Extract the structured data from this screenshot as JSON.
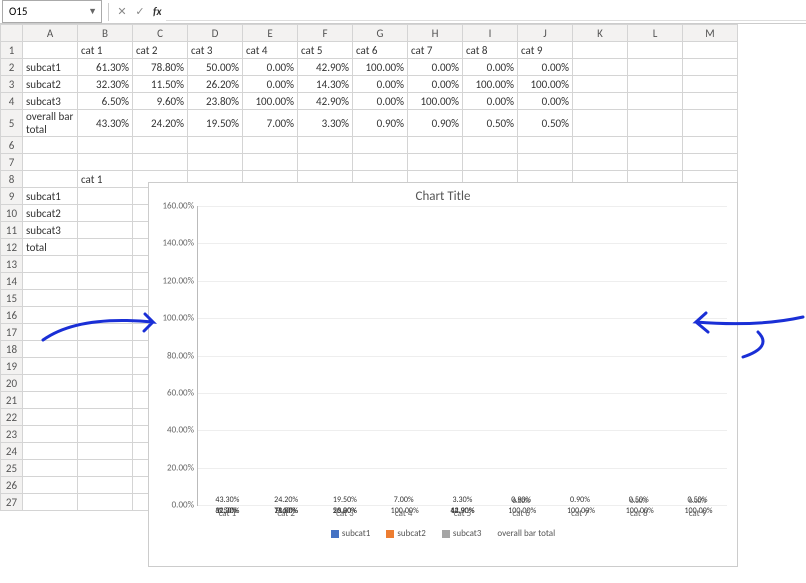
{
  "namebox": {
    "value": "O15"
  },
  "fbar": {
    "cancel": "✕",
    "accept": "✓",
    "fx": "fx"
  },
  "cols": [
    "",
    "A",
    "B",
    "C",
    "D",
    "E",
    "F",
    "G",
    "H",
    "I",
    "J",
    "K",
    "L",
    "M"
  ],
  "row_headers": [
    "cat 1",
    "cat 2",
    "cat 3",
    "cat 4",
    "cat 5",
    "cat 6",
    "cat 7",
    "cat 8",
    "cat 9"
  ],
  "row_labels": [
    "subcat1",
    "subcat2",
    "subcat3",
    "overall bar total"
  ],
  "data": [
    [
      "61.30%",
      "78.80%",
      "50.00%",
      "0.00%",
      "42.90%",
      "100.00%",
      "0.00%",
      "0.00%",
      "0.00%"
    ],
    [
      "32.30%",
      "11.50%",
      "26.20%",
      "0.00%",
      "14.30%",
      "0.00%",
      "0.00%",
      "100.00%",
      "100.00%"
    ],
    [
      "6.50%",
      "9.60%",
      "23.80%",
      "100.00%",
      "42.90%",
      "0.00%",
      "100.00%",
      "0.00%",
      "0.00%"
    ],
    [
      "43.30%",
      "24.20%",
      "19.50%",
      "7.00%",
      "3.30%",
      "0.90%",
      "0.90%",
      "0.50%",
      "0.50%"
    ]
  ],
  "lower": {
    "B8": "cat 1",
    "A9": "subcat1",
    "A10": "subcat2",
    "A11": "subcat3",
    "A12": "total"
  },
  "chart_data": {
    "type": "bar",
    "title": "Chart Title",
    "categories": [
      "cat 1",
      "cat 2",
      "cat 3",
      "cat 4",
      "cat 5",
      "cat 6",
      "cat 7",
      "cat 8",
      "cat 9"
    ],
    "series": [
      {
        "name": "subcat1",
        "color": "#4472c4",
        "values": [
          61.3,
          78.8,
          50.0,
          0.0,
          42.9,
          100.0,
          0.0,
          0.0,
          0.0
        ]
      },
      {
        "name": "subcat2",
        "color": "#ed7d31",
        "values": [
          32.3,
          11.5,
          26.2,
          0.0,
          14.3,
          0.0,
          0.0,
          100.0,
          100.0
        ]
      },
      {
        "name": "subcat3",
        "color": "#a5a5a5",
        "values": [
          6.5,
          9.6,
          23.8,
          100.0,
          42.9,
          0.0,
          100.0,
          0.0,
          0.0
        ]
      }
    ],
    "totals_label_series": {
      "name": "overall bar total",
      "values": [
        43.3,
        24.2,
        19.5,
        7.0,
        3.3,
        0.9,
        0.9,
        0.5,
        0.5
      ]
    },
    "ylabel": "",
    "xlabel": "",
    "yticks": [
      0,
      20,
      40,
      60,
      80,
      100,
      120,
      140,
      160
    ],
    "ylim": [
      0,
      160
    ],
    "stacked": true,
    "legend_position": "bottom"
  }
}
